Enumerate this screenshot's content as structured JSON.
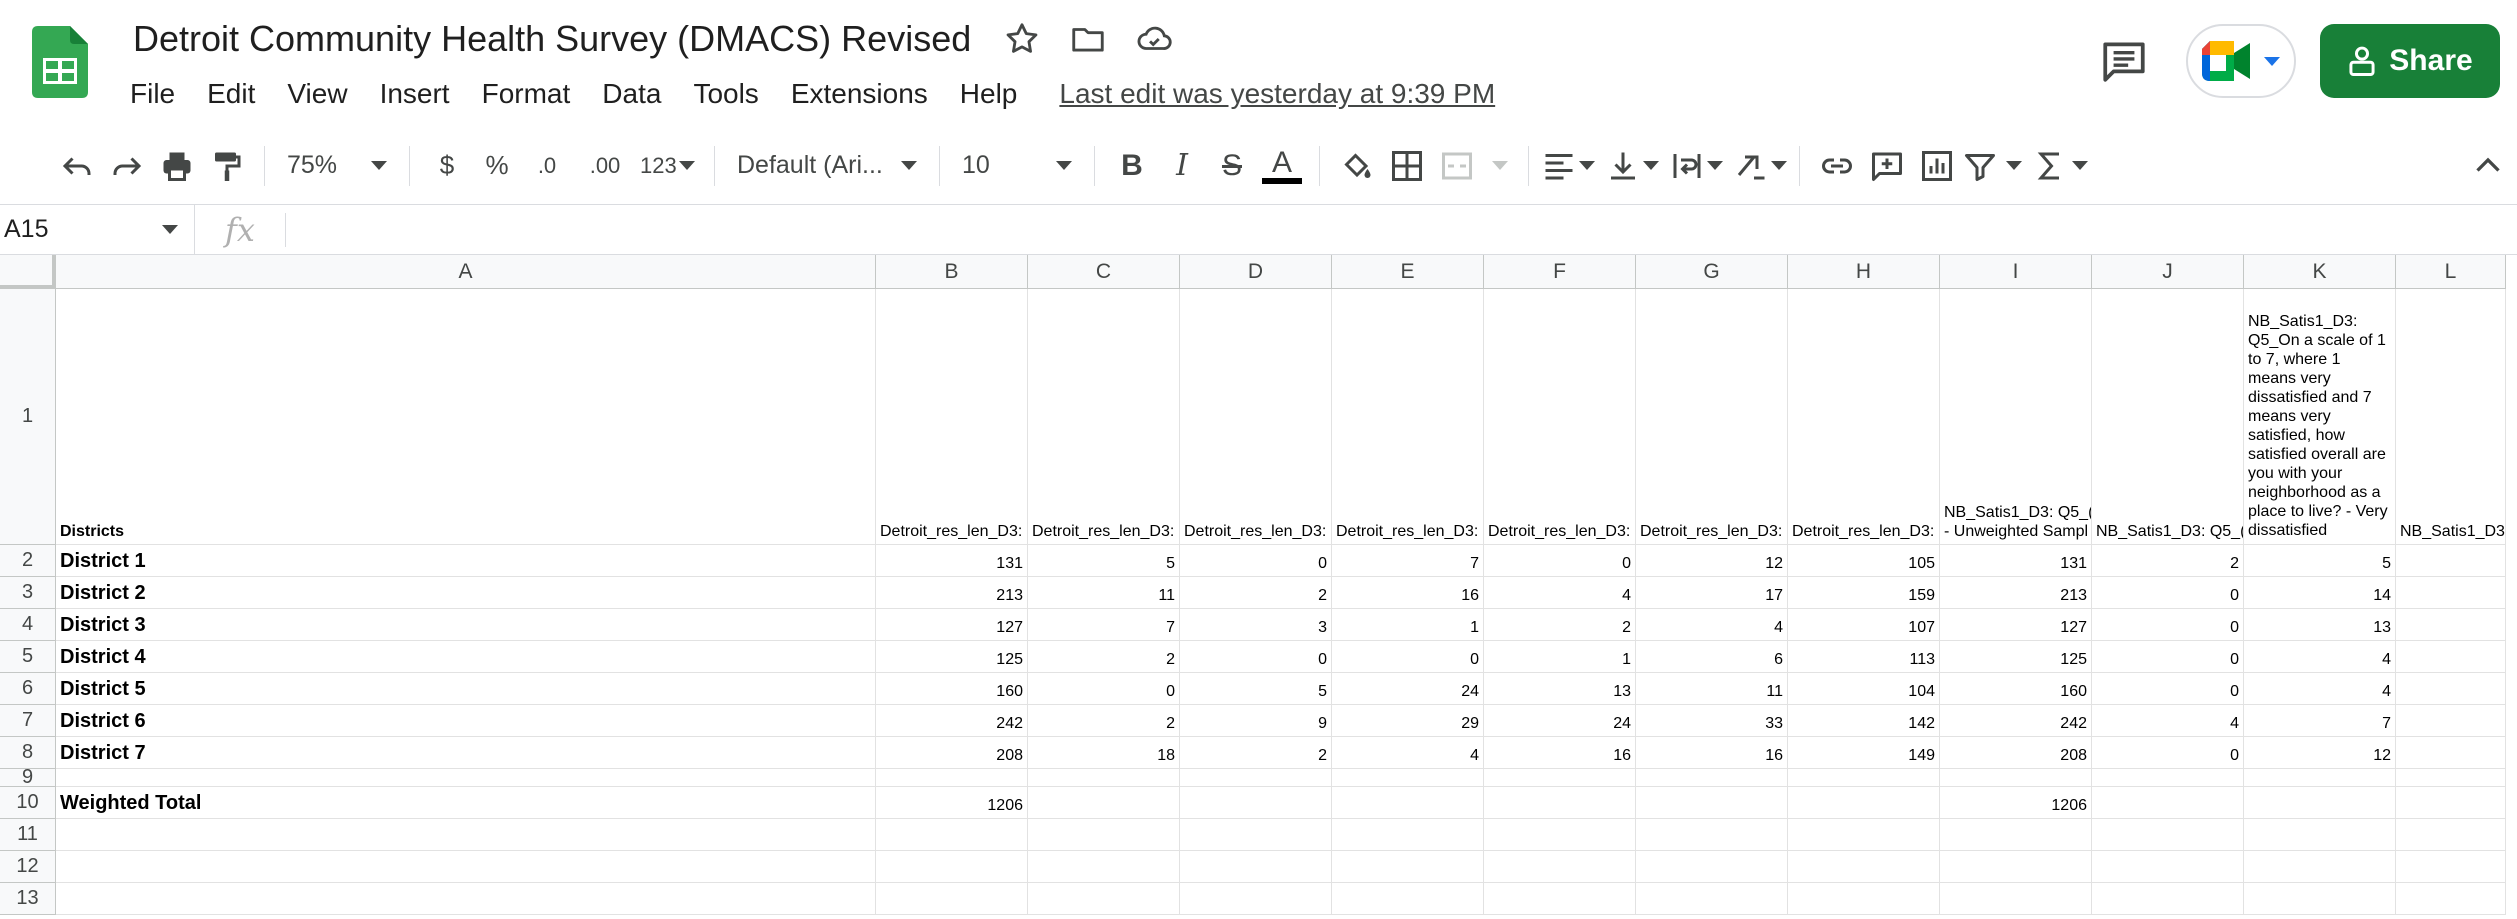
{
  "app": {
    "doc_title": "Detroit Community Health Survey (DMACS) Revised",
    "menu": [
      "File",
      "Edit",
      "View",
      "Insert",
      "Format",
      "Data",
      "Tools",
      "Extensions",
      "Help"
    ],
    "last_edit": "Last edit was yesterday at 9:39 PM",
    "share_label": "Share",
    "brand_color": "#188038"
  },
  "toolbar": {
    "zoom": "75%",
    "currency": "$",
    "percent": "%",
    "dec_decrease": ".0",
    "dec_increase": ".00",
    "more_formats": "123",
    "font": "Default (Ari...",
    "font_size": "10",
    "bold": "B",
    "italic": "I",
    "strike": "S",
    "text_color": "A"
  },
  "formula_bar": {
    "name_box": "A15",
    "fx": "fx",
    "value": ""
  },
  "grid": {
    "columns": [
      "A",
      "B",
      "C",
      "D",
      "E",
      "F",
      "G",
      "H",
      "I",
      "J",
      "K",
      "L"
    ],
    "rows": [
      "1",
      "2",
      "3",
      "4",
      "5",
      "6",
      "7",
      "8",
      "9",
      "10",
      "11",
      "12",
      "13"
    ],
    "header": {
      "A": "Districts",
      "B": "Detroit_res_len_D3:",
      "C": "Detroit_res_len_D3:",
      "D": "Detroit_res_len_D3:",
      "E": "Detroit_res_len_D3:",
      "F": "Detroit_res_len_D3:",
      "G": "Detroit_res_len_D3:",
      "H": "Detroit_res_len_D3:",
      "I_line1": "NB_Satis1_D3: Q5_(",
      "I_line2": "- Unweighted Sampl",
      "J": "NB_Satis1_D3: Q5_(",
      "K": "NB_Satis1_D3: Q5_On a scale of 1 to 7, where 1 means very dissatisfied and 7 means very satisfied, how satisfied overall are you with your neighborhood as a place to live? - Very dissatisfied",
      "L": "NB_Satis1_D3"
    },
    "data_rows": [
      {
        "label": "District 1",
        "values": [
          "131",
          "5",
          "0",
          "7",
          "0",
          "12",
          "105",
          "131",
          "2",
          "5"
        ]
      },
      {
        "label": "District 2",
        "values": [
          "213",
          "11",
          "2",
          "16",
          "4",
          "17",
          "159",
          "213",
          "0",
          "14"
        ]
      },
      {
        "label": "District 3",
        "values": [
          "127",
          "7",
          "3",
          "1",
          "2",
          "4",
          "107",
          "127",
          "0",
          "13"
        ]
      },
      {
        "label": "District 4",
        "values": [
          "125",
          "2",
          "0",
          "0",
          "1",
          "6",
          "113",
          "125",
          "0",
          "4"
        ]
      },
      {
        "label": "District 5",
        "values": [
          "160",
          "0",
          "5",
          "24",
          "13",
          "11",
          "104",
          "160",
          "0",
          "4"
        ]
      },
      {
        "label": "District 6",
        "values": [
          "242",
          "2",
          "9",
          "29",
          "24",
          "33",
          "142",
          "242",
          "4",
          "7"
        ]
      },
      {
        "label": "District 7",
        "values": [
          "208",
          "18",
          "2",
          "4",
          "16",
          "16",
          "149",
          "208",
          "0",
          "12"
        ]
      }
    ],
    "total_row": {
      "label": "Weighted Total",
      "B": "1206",
      "I": "1206"
    }
  }
}
